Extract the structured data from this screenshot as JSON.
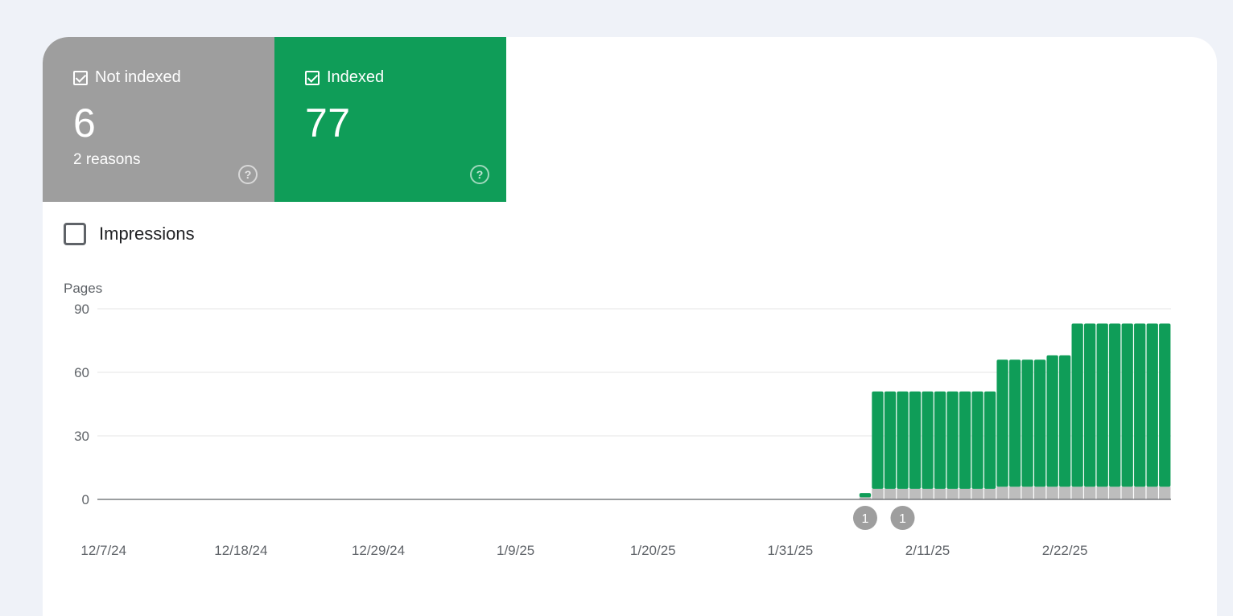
{
  "tiles": [
    {
      "label": "Not indexed",
      "value": "6",
      "sub": "2 reasons",
      "color": "#9e9e9e"
    },
    {
      "label": "Indexed",
      "value": "77",
      "sub": "",
      "color": "#0f9d58"
    }
  ],
  "impressions": {
    "label": "Impressions",
    "checked": false
  },
  "colors": {
    "indexed": "#0f9d58",
    "not_indexed": "#bdbdbd",
    "grid": "#e6e6e6"
  },
  "chart_data": {
    "type": "bar",
    "stacked": true,
    "ylabel": "Pages",
    "ylim": [
      0,
      90
    ],
    "yticks": [
      0,
      30,
      60,
      90
    ],
    "grid": true,
    "x_start": "2024-12-07",
    "x_end": "2025-03-02",
    "xtick_labels": [
      "12/7/24",
      "12/18/24",
      "12/29/24",
      "1/9/25",
      "1/20/25",
      "1/31/25",
      "2/11/25",
      "2/22/25"
    ],
    "categories": [
      "2/6/25",
      "2/7/25",
      "2/8/25",
      "2/9/25",
      "2/10/25",
      "2/11/25",
      "2/12/25",
      "2/13/25",
      "2/14/25",
      "2/15/25",
      "2/16/25",
      "2/17/25",
      "2/18/25",
      "2/19/25",
      "2/20/25",
      "2/21/25",
      "2/22/25",
      "2/23/25",
      "2/24/25",
      "2/25/25",
      "2/26/25",
      "2/27/25",
      "2/28/25",
      "3/1/25",
      "3/2/25"
    ],
    "series": [
      {
        "name": "Not indexed",
        "values": [
          1,
          5,
          5,
          5,
          5,
          5,
          5,
          5,
          5,
          5,
          5,
          6,
          6,
          6,
          6,
          6,
          6,
          6,
          6,
          6,
          6,
          6,
          6,
          6,
          6
        ]
      },
      {
        "name": "Indexed",
        "values": [
          2,
          46,
          46,
          46,
          46,
          46,
          46,
          46,
          46,
          46,
          46,
          60,
          60,
          60,
          60,
          62,
          62,
          77,
          77,
          77,
          77,
          77,
          77,
          77,
          77
        ]
      }
    ],
    "annotations": [
      {
        "date": "2/6/25",
        "label": "1"
      },
      {
        "date": "2/9/25",
        "label": "1"
      }
    ]
  }
}
